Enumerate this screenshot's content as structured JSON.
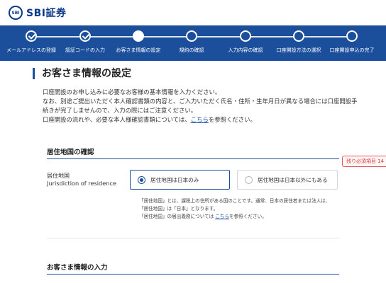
{
  "header": {
    "logo_mark_text": "SBI",
    "logo_text": "SBI証券"
  },
  "progress": {
    "steps": [
      {
        "label": "メールアドレスの登録",
        "state": "done"
      },
      {
        "label": "認証コードの入力",
        "state": "done"
      },
      {
        "label": "お客さま情報の設定",
        "state": "current"
      },
      {
        "label": "規約の確認",
        "state": "todo"
      },
      {
        "label": "入力内容の確認",
        "state": "todo"
      },
      {
        "label": "口座開設方法の選択",
        "state": "todo"
      },
      {
        "label": "口座開設申込の完了",
        "state": "todo"
      }
    ]
  },
  "main": {
    "title": "お客さま情報の設定",
    "intro": {
      "line1": "口座開設のお申し込みに必要なお客様の基本情報を入力ください。",
      "line2": "なお、別途ご提出いただく本人確認書類の内容と、ご入力いただく氏名・住所・生年月日が異なる場合には口座開設手",
      "line3": "続きが完了しませんので、入力の際にはご注意ください。",
      "line4_pre": "口座開設の流れや、必要な本人様確認書類については、",
      "line4_link": "こちら",
      "line4_post": "を参照ください。"
    },
    "section1": {
      "heading": "居住地国の確認",
      "required_badge": "残り必須項目 14",
      "field_label_jp": "居住地国",
      "field_label_en": "Jurisdiction of residence",
      "options": [
        {
          "label": "居住地国は日本のみ",
          "selected": true
        },
        {
          "label": "居住地国は日本以外にもある",
          "selected": false
        }
      ],
      "note": {
        "line1": "「居住地国」とは、課税上の住所がある国のことです。通常、日本の居住者または法人は、",
        "line2": "「居住地国」は「日本」となります。",
        "line3_pre": "「居住地国」の届出義務については ",
        "line3_link": "こちら",
        "line3_post": "を参照ください。"
      }
    },
    "section2": {
      "heading": "お客さま情報の入力"
    }
  },
  "colors": {
    "brand_blue": "#1b4f9b",
    "required_red": "#d23b3b",
    "link": "#1a4fa3"
  }
}
